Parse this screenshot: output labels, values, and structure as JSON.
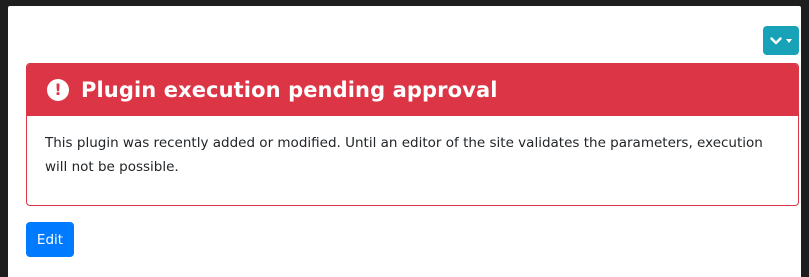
{
  "toolbar": {
    "dropdown_icon": "chevron-down-icon"
  },
  "alert": {
    "icon": "exclamation-circle-icon",
    "icon_glyph": "!",
    "title": "Plugin execution pending approval",
    "message": "This plugin was recently added or modified. Until an editor of the site validates the parameters, execution will not be possible.",
    "color": "#dc3545"
  },
  "actions": {
    "edit_label": "Edit",
    "edit_color": "#007bff"
  },
  "colors": {
    "dropdown": "#17a2b8",
    "background": "#1e1e1e"
  }
}
